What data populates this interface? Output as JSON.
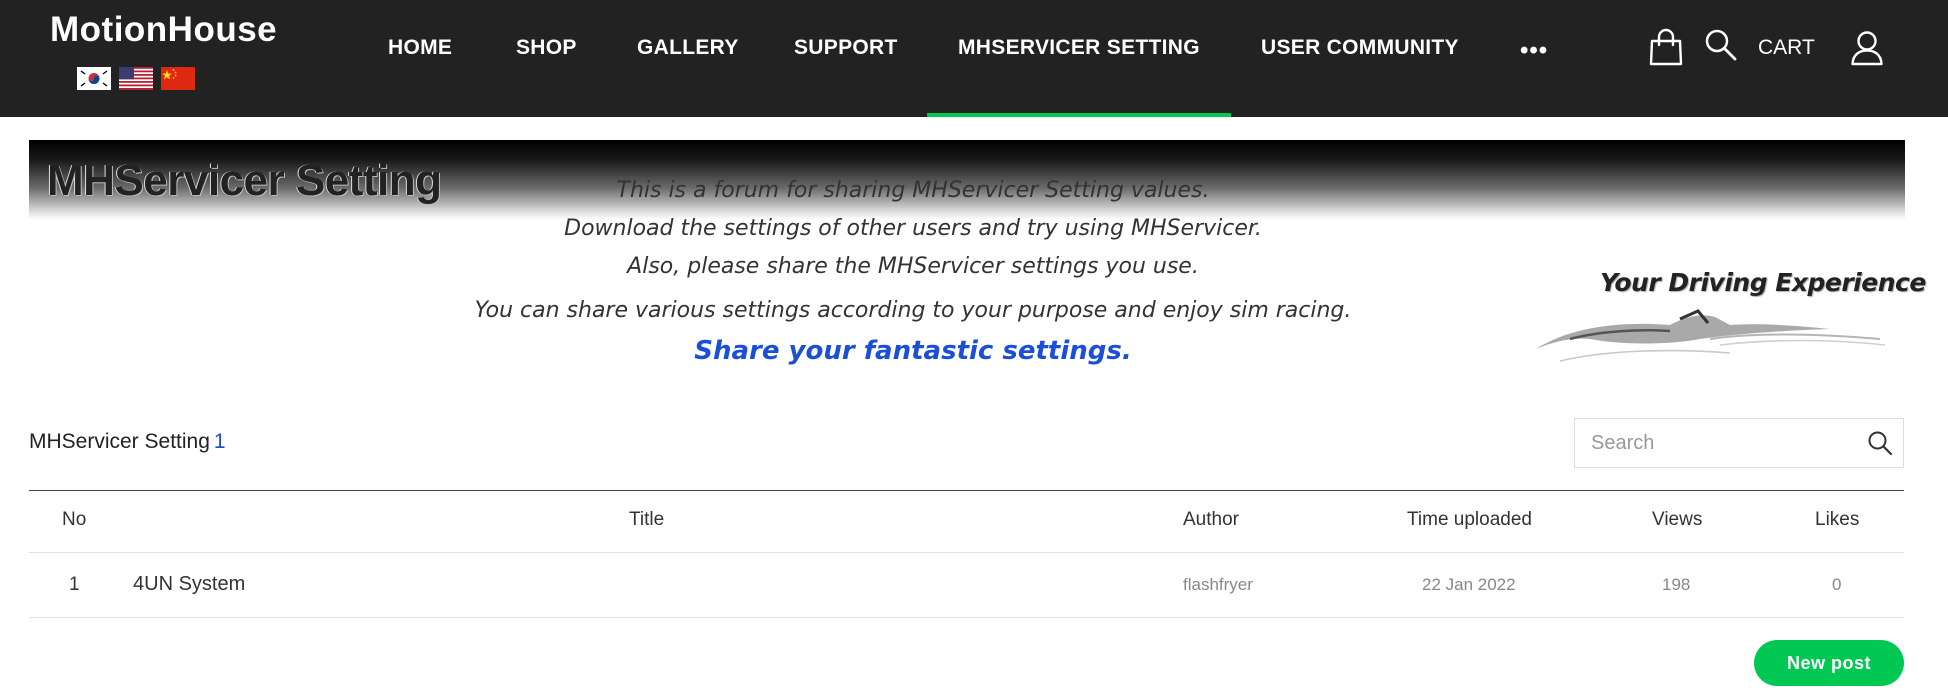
{
  "header": {
    "logo": "MotionHouse",
    "flags": [
      "korean-flag-icon",
      "us-flag-icon",
      "china-flag-icon"
    ],
    "nav": [
      {
        "label": "HOME"
      },
      {
        "label": "SHOP"
      },
      {
        "label": "GALLERY"
      },
      {
        "label": "SUPPORT"
      },
      {
        "label": "MHSERVICER SETTING",
        "active": true
      },
      {
        "label": "USER COMMUNITY"
      }
    ],
    "more": "•••",
    "cart_label": "CART",
    "accent_color": "#00c853"
  },
  "banner": {
    "title": "MHServicer Setting",
    "lines": [
      "This is a forum for sharing MHServicer Setting values.",
      "Download the settings of other users and try using MHServicer.",
      "Also, please share the MHServicer settings you use.",
      "You can share various settings according to your purpose and enjoy sim racing."
    ],
    "highlight": "Share your fantastic settings.",
    "tagline": "Your Driving  Experience",
    "highlight_color": "#1a4fd6"
  },
  "board": {
    "title": "MHServicer Setting",
    "count": "1",
    "search_placeholder": "Search",
    "columns": {
      "no": "No",
      "title": "Title",
      "author": "Author",
      "time": "Time uploaded",
      "views": "Views",
      "likes": "Likes"
    },
    "rows": [
      {
        "no": "1",
        "title": "4UN System",
        "author": "flashfryer",
        "time": "22 Jan 2022",
        "views": "198",
        "likes": "0"
      }
    ],
    "new_post_label": "New post"
  }
}
